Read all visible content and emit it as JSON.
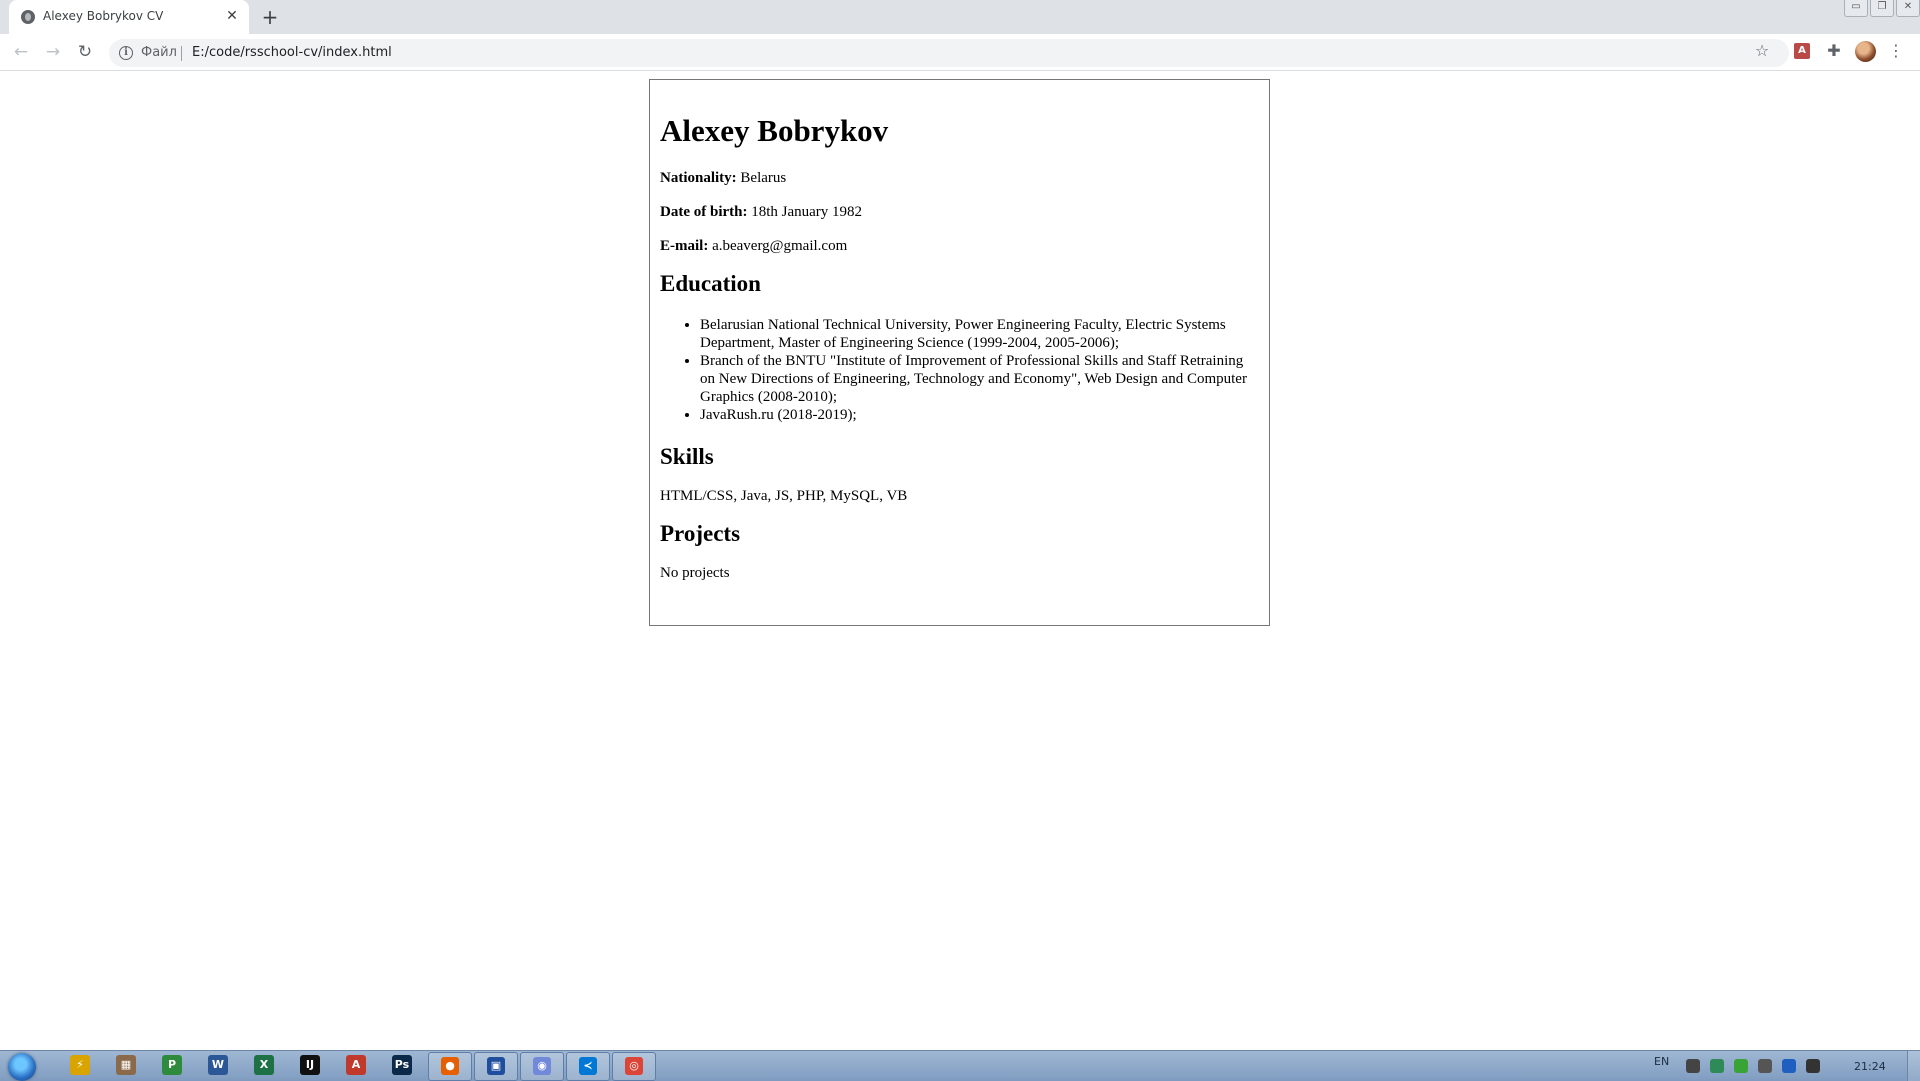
{
  "browser": {
    "tab": {
      "title": "Alexey Bobrykov CV",
      "close_glyph": "✕"
    },
    "new_tab_glyph": "+",
    "window_controls": [
      "▭",
      "❐",
      "✕"
    ],
    "nav": {
      "back_glyph": "←",
      "forward_glyph": "→",
      "reload_glyph": "↻"
    },
    "omnibox": {
      "info_glyph": "i",
      "scheme_label": "Файл",
      "url": "E:/code/rsschool-cv/index.html"
    },
    "star_glyph": "☆",
    "extension_pdf_label": "A",
    "extension_glyph": "✚",
    "menu_glyph": "⋮"
  },
  "cv": {
    "name": "Alexey Bobrykov",
    "nationality_label": "Nationality:",
    "nationality": " Belarus",
    "dob_label": "Date of birth:",
    "dob": " 18th January 1982",
    "email_label": "E-mail:",
    "email": " a.beaverg@gmail.com",
    "education_heading": "Education",
    "education": [
      "Belarusian National Technical University, Power Engineering Faculty, Electric Systems Department, Master of Engineering Science (1999-2004, 2005-2006);",
      "Branch of the BNTU \"Institute of Improvement of Professional Skills and Staff Retraining on New Directions of Engineering, Technology and Economy\", Web Design and Computer Graphics (2008-2010);",
      "JavaRush.ru (2018-2019);"
    ],
    "skills_heading": "Skills",
    "skills": "HTML/CSS, Java, JS, PHP, MySQL, VB",
    "projects_heading": "Projects",
    "projects": "No projects"
  },
  "taskbar": {
    "apps": [
      {
        "name": "shortcut-app",
        "glyph": "⚡",
        "color": "#d9a400"
      },
      {
        "name": "file-manager",
        "glyph": "▦",
        "color": "#8a6a4a"
      },
      {
        "name": "project",
        "glyph": "P",
        "color": "#2e8b3e"
      },
      {
        "name": "word",
        "glyph": "W",
        "color": "#2b5797"
      },
      {
        "name": "excel",
        "glyph": "X",
        "color": "#1e7145"
      },
      {
        "name": "intellij",
        "glyph": "IJ",
        "color": "#111111"
      },
      {
        "name": "acrobat",
        "glyph": "A",
        "color": "#c0392b"
      },
      {
        "name": "photoshop",
        "glyph": "Ps",
        "color": "#0b2a4a"
      }
    ],
    "running_apps": [
      {
        "name": "firefox",
        "glyph": "●",
        "color": "#e66000"
      },
      {
        "name": "save-app",
        "glyph": "▣",
        "color": "#1f4e9c"
      },
      {
        "name": "discord",
        "glyph": "◉",
        "color": "#7289da"
      },
      {
        "name": "vscode",
        "glyph": "≺",
        "color": "#0078d4"
      },
      {
        "name": "chrome",
        "glyph": "◎",
        "color": "#db4437"
      }
    ],
    "language": "EN",
    "clock": "21:24",
    "tray_colors": [
      "#444444",
      "#2e8b57",
      "#3aa335",
      "#555555",
      "#1f5fbf",
      "#333333"
    ]
  }
}
